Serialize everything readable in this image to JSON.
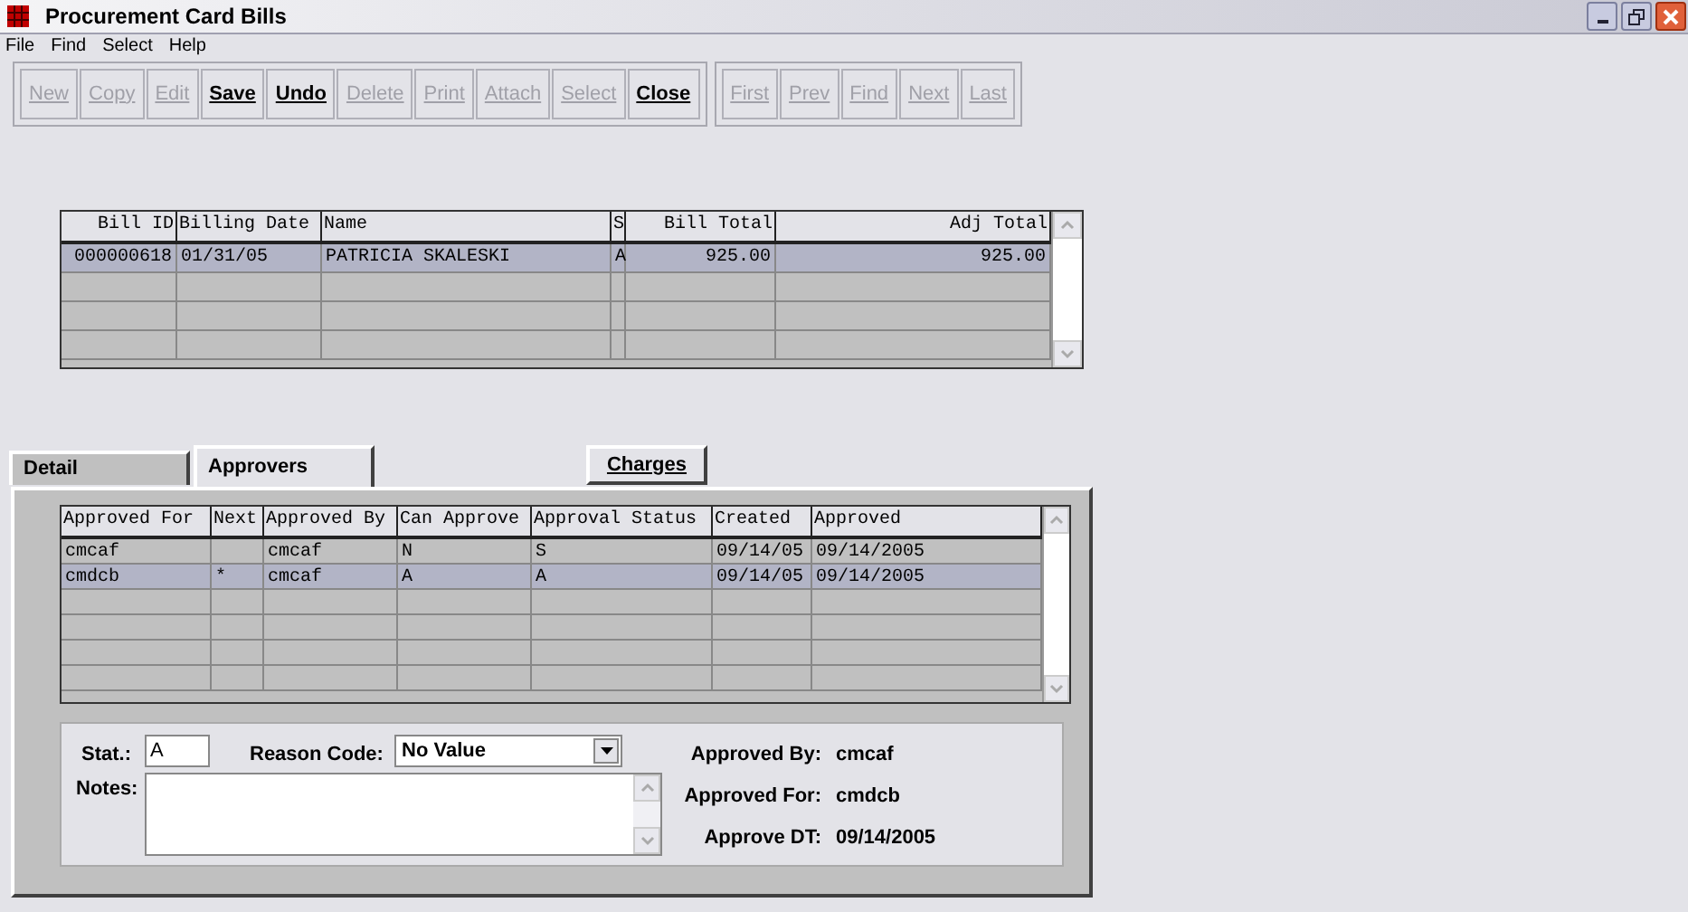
{
  "window": {
    "title": "Procurement Card Bills"
  },
  "menu": [
    "File",
    "Find",
    "Select",
    "Help"
  ],
  "toolbar": [
    {
      "label": "New",
      "disabled": true
    },
    {
      "label": "Copy",
      "disabled": true
    },
    {
      "label": "Edit",
      "disabled": true
    },
    {
      "label": "Save",
      "disabled": false
    },
    {
      "label": "Undo",
      "disabled": false
    },
    {
      "label": "Delete",
      "disabled": true
    },
    {
      "label": "Print",
      "disabled": true
    },
    {
      "label": "Attach",
      "disabled": true
    },
    {
      "label": "Select",
      "disabled": true
    },
    {
      "label": "Close",
      "disabled": false
    }
  ],
  "nav_toolbar": [
    {
      "label": "First",
      "disabled": true
    },
    {
      "label": "Prev",
      "disabled": true
    },
    {
      "label": "Find",
      "disabled": true
    },
    {
      "label": "Next",
      "disabled": true
    },
    {
      "label": "Last",
      "disabled": true
    }
  ],
  "bills": {
    "columns": [
      "Bill ID",
      "Billing Date",
      "Name",
      "S",
      "Bill Total",
      "Adj Total"
    ],
    "rows": [
      {
        "cells": [
          "000000618",
          "01/31/05",
          "PATRICIA SKALESKI",
          "A",
          "925.00",
          "925.00"
        ],
        "selected": true
      }
    ]
  },
  "tabs": [
    {
      "label": "Detail",
      "selected": false
    },
    {
      "label": "Approvers",
      "selected": true
    },
    {
      "label": "Charges",
      "selected": false
    }
  ],
  "approvers": {
    "columns": [
      "Approved For",
      "Next",
      "Approved By",
      "Can Approve",
      "Approval Status",
      "Created",
      "Approved"
    ],
    "rows": [
      {
        "cells": [
          "cmcaf",
          "",
          "cmcaf",
          "N",
          "S",
          "09/14/05",
          "09/14/2005"
        ],
        "selected": false
      },
      {
        "cells": [
          "cmdcb",
          "*",
          "cmcaf",
          "A",
          "A",
          "09/14/05",
          "09/14/2005"
        ],
        "selected": true
      }
    ]
  },
  "form": {
    "stat_label": "Stat.:",
    "stat_value": "A",
    "reason_label": "Reason Code:",
    "reason_value": "No Value",
    "notes_label": "Notes:",
    "info": [
      {
        "label": "Approved By:",
        "value": "cmcaf"
      },
      {
        "label": "Approved For:",
        "value": "cmdcb"
      },
      {
        "label": "Approve DT:",
        "value": "09/14/2005"
      }
    ]
  }
}
